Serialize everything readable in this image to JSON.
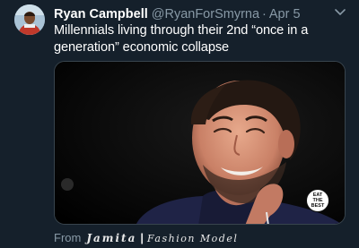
{
  "tweet": {
    "display_name": "Ryan Campbell",
    "handle": "@RyanForSmyrna",
    "separator": "·",
    "date": "Apr 5",
    "text": "Millennials living through their 2nd “once in a generation” economic collapse"
  },
  "media": {
    "sticker_text": "EAT\nTHE\nBEST"
  },
  "source": {
    "prefix": "From",
    "name": "Jamita",
    "separator": "|",
    "brand": "Fashion Model"
  },
  "colors": {
    "background": "#15202b",
    "secondary_text": "#8899a6"
  },
  "icons": {
    "avatar": "profile-photo",
    "caret": "chevron-down-icon"
  }
}
